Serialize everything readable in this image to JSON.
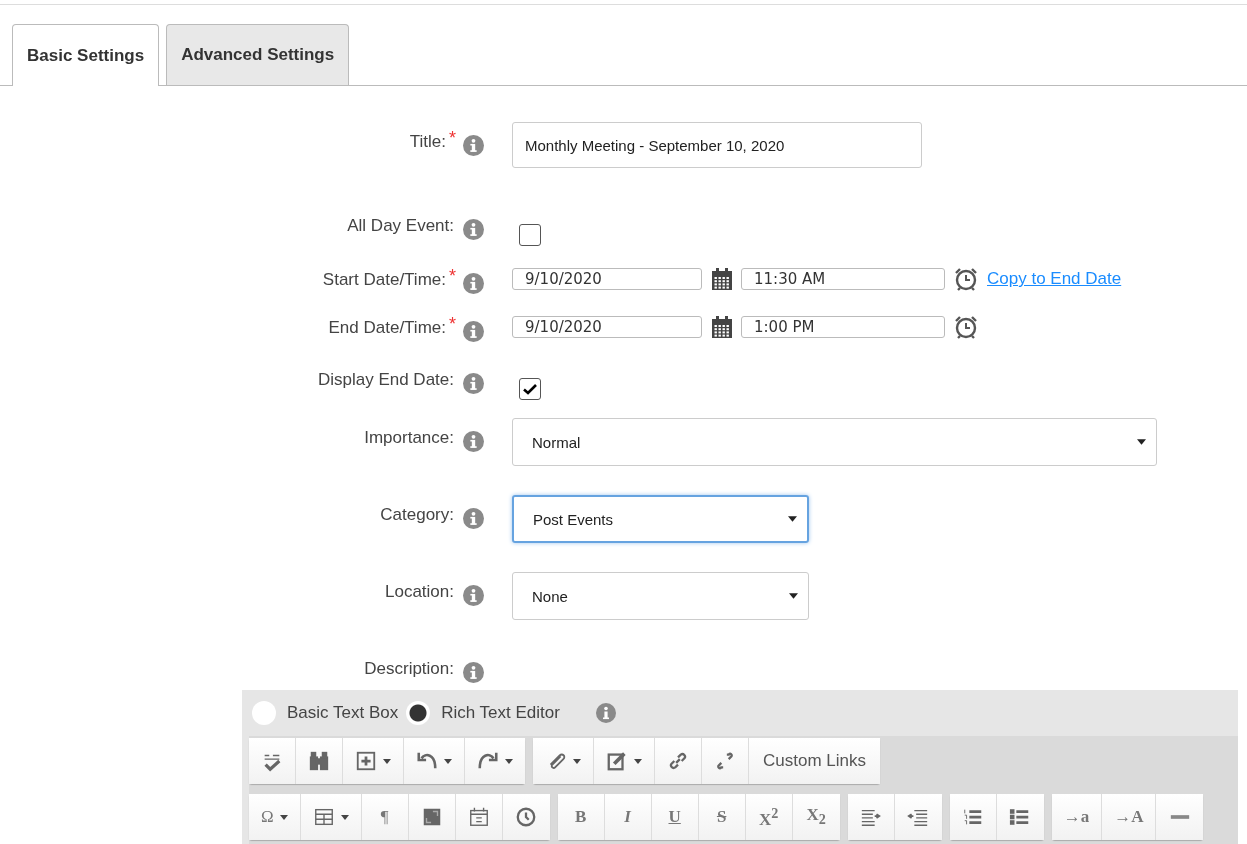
{
  "tabs": [
    {
      "label": "Basic Settings",
      "selected": true
    },
    {
      "label": "Advanced Settings",
      "selected": false
    }
  ],
  "fields": [
    {
      "kind": "text",
      "label": "Title:",
      "required_mark": "*",
      "value": "Monthly Meeting - September 10, 2020"
    },
    {
      "kind": "checkbox",
      "label": "All Day Event:",
      "checked": false
    },
    {
      "kind": "datetime",
      "label": "Start Date/Time:",
      "required_mark": "*",
      "date": "9/10/2020",
      "time": "11:30 AM",
      "link": "Copy to End Date"
    },
    {
      "kind": "datetime",
      "label": "End Date/Time:",
      "required_mark": "*",
      "date": "9/10/2020",
      "time": "1:00 PM"
    },
    {
      "kind": "checkbox",
      "label": "Display End Date:",
      "checked": true
    },
    {
      "kind": "select",
      "label": "Importance:",
      "value": "Normal",
      "focused": false
    },
    {
      "kind": "select",
      "label": "Category:",
      "value": "Post Events",
      "focused": true
    },
    {
      "kind": "select",
      "label": "Location:",
      "value": "None",
      "focused": false
    },
    {
      "kind": "heading",
      "label": "Description:"
    }
  ],
  "editor": {
    "modes": [
      {
        "label": "Basic Text Box",
        "selected": false
      },
      {
        "label": "Rich Text Editor",
        "selected": true
      }
    ],
    "toolbar": [
      [
        [
          {
            "kind": "icon",
            "dropdown": false
          },
          {
            "kind": "icon",
            "dropdown": false
          },
          {
            "kind": "icon",
            "dropdown": true
          },
          {
            "kind": "icon",
            "dropdown": true
          },
          {
            "kind": "icon",
            "dropdown": true
          }
        ],
        [
          {
            "kind": "icon",
            "dropdown": true
          },
          {
            "kind": "icon",
            "dropdown": true
          },
          {
            "kind": "icon",
            "dropdown": false
          },
          {
            "kind": "icon",
            "dropdown": false
          },
          {
            "kind": "text",
            "label": "Custom Links",
            "dropdown": false
          }
        ]
      ],
      [
        [
          {
            "kind": "text",
            "label": "Ω",
            "dropdown": true
          },
          {
            "kind": "icon",
            "dropdown": true
          },
          {
            "kind": "text",
            "label": "¶",
            "dropdown": false
          },
          {
            "kind": "icon",
            "dropdown": false
          },
          {
            "kind": "icon",
            "dropdown": false
          },
          {
            "kind": "icon",
            "dropdown": false
          }
        ],
        [
          {
            "kind": "text",
            "label": "B",
            "dropdown": false
          },
          {
            "kind": "text",
            "label": "I",
            "dropdown": false
          },
          {
            "kind": "text",
            "label": "U",
            "dropdown": false
          },
          {
            "kind": "text",
            "label": "S",
            "dropdown": false
          },
          {
            "kind": "text",
            "label": "X$^{2}$",
            "dropdown": false
          },
          {
            "kind": "text",
            "label": "X$_{2}$",
            "dropdown": false
          }
        ],
        [
          {
            "kind": "icon",
            "dropdown": false
          },
          {
            "kind": "icon",
            "dropdown": false
          }
        ],
        [
          {
            "kind": "icon",
            "dropdown": false
          },
          {
            "kind": "icon",
            "dropdown": false
          }
        ],
        [
          {
            "kind": "text",
            "label": "→a",
            "dropdown": false
          },
          {
            "kind": "text",
            "label": "→A",
            "dropdown": false
          },
          {
            "kind": "icon",
            "dropdown": false
          }
        ]
      ]
    ]
  }
}
